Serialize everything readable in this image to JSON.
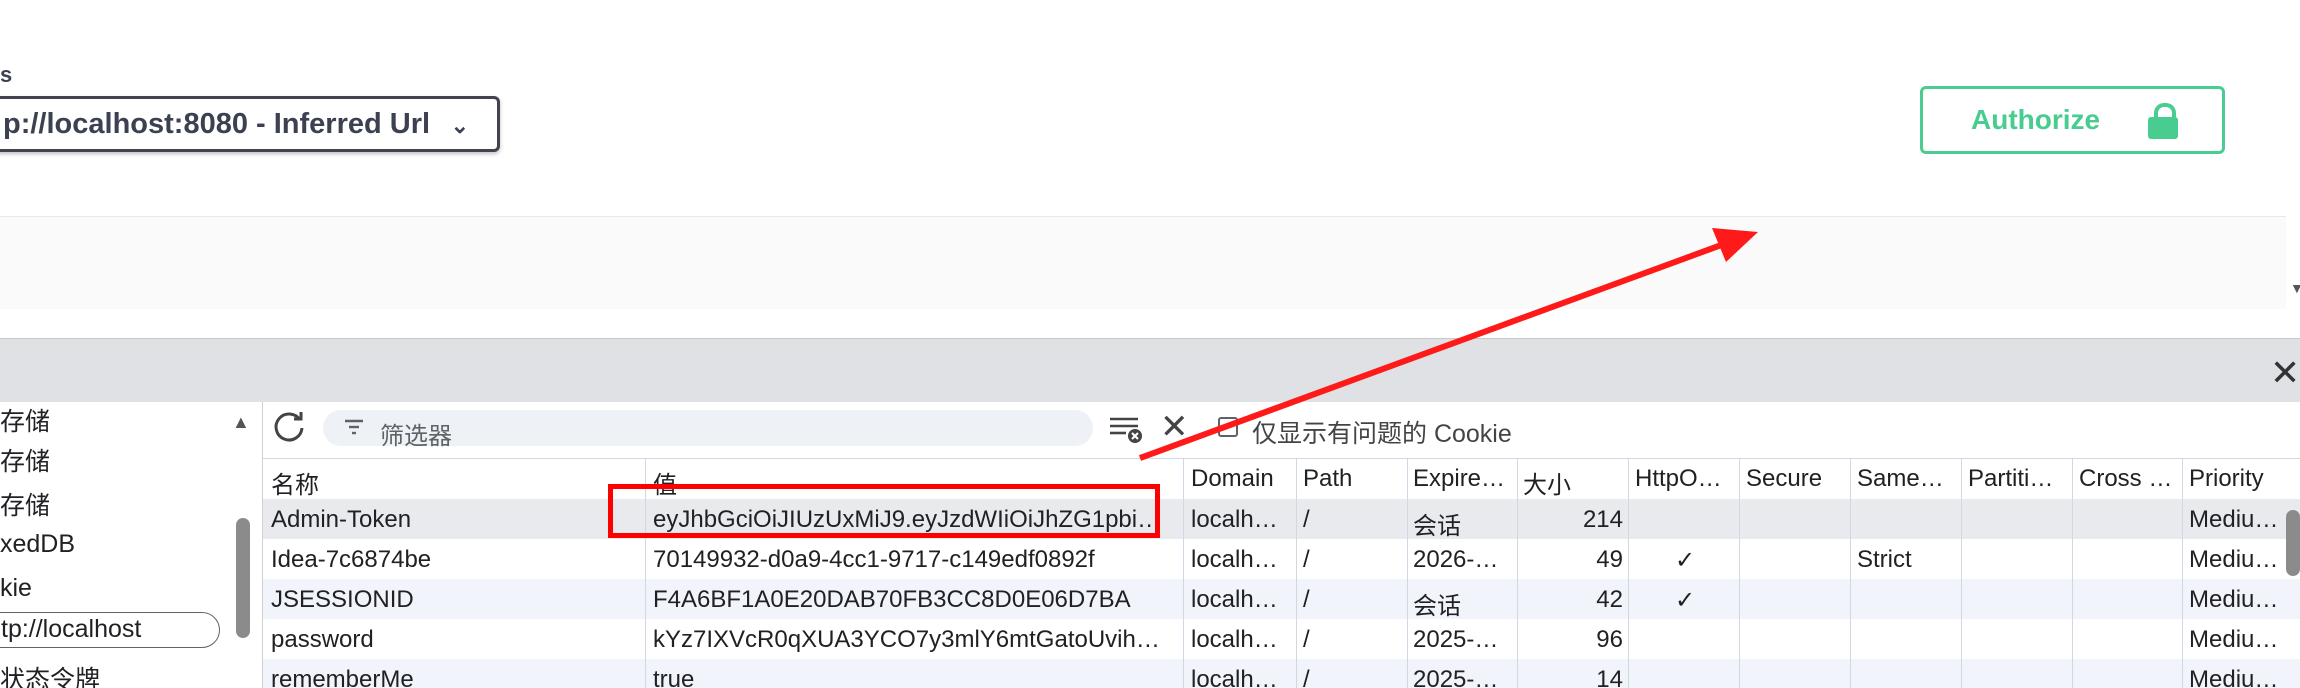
{
  "swagger": {
    "servers_label": "s",
    "server_selected": "p://localhost:8080 - Inferred Url",
    "authorize_label": "Authorize"
  },
  "devtools": {
    "sidebar": {
      "items": [
        "存储",
        "存储",
        "存储",
        "xedDB",
        "kie",
        "tp://localhost",
        "状态令牌"
      ]
    },
    "toolbar": {
      "filter_placeholder": "筛选器",
      "only_issues_label": "仅显示有问题的 Cookie"
    },
    "table": {
      "headers": [
        "名称",
        "值",
        "Domain",
        "Path",
        "Expire…",
        "大小",
        "HttpO…",
        "Secure",
        "Same…",
        "Partiti…",
        "Cross …",
        "Priority"
      ],
      "rows": [
        [
          "Admin-Token",
          "eyJhbGciOiJIUzUxMiJ9.eyJzdWIiOiJhZG1pbi…",
          "localh…",
          "/",
          "会话",
          "214",
          "",
          "",
          "",
          "",
          "",
          "Mediu…"
        ],
        [
          "Idea-7c6874be",
          "70149932-d0a9-4cc1-9717-c149edf0892f",
          "localh…",
          "/",
          "2026-…",
          "49",
          "✓",
          "",
          "Strict",
          "",
          "",
          "Mediu…"
        ],
        [
          "JSESSIONID",
          "F4A6BF1A0E20DAB70FB3CC8D0E06D7BA",
          "localh…",
          "/",
          "会话",
          "42",
          "✓",
          "",
          "",
          "",
          "",
          "Mediu…"
        ],
        [
          "password",
          "kYz7IXVcR0qXUA3YCO7y3mlY6mtGatoUvih…",
          "localh…",
          "/",
          "2025-…",
          "96",
          "",
          "",
          "",
          "",
          "",
          "Mediu…"
        ],
        [
          "rememberMe",
          "true",
          "localh…",
          "/",
          "2025-…",
          "14",
          "",
          "",
          "",
          "",
          "",
          "Mediu…"
        ]
      ]
    }
  },
  "colors": {
    "authorize_green": "#49cc90",
    "annotation_red": "#ff0000",
    "selected_row": "#e8eaed",
    "alt_row": "#f1f4fb"
  }
}
